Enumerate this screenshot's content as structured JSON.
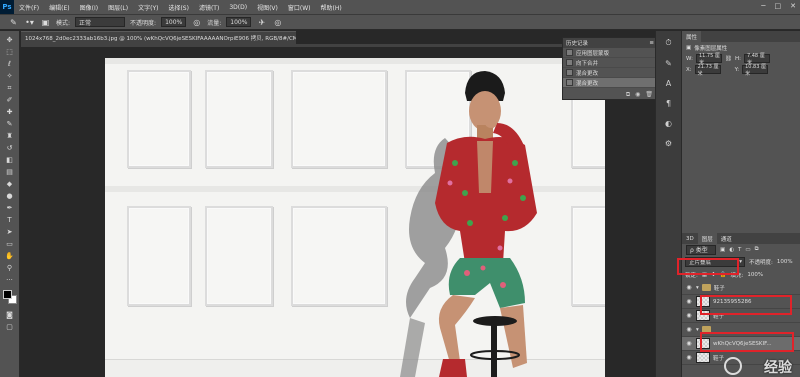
{
  "app": {
    "logo": "Ps"
  },
  "menu": [
    "文件(F)",
    "编辑(E)",
    "图像(I)",
    "图层(L)",
    "文字(Y)",
    "选择(S)",
    "滤镜(T)",
    "3D(D)",
    "视图(V)",
    "窗口(W)",
    "帮助(H)"
  ],
  "window_controls": [
    "─",
    "□",
    "✕"
  ],
  "options": {
    "mode_label": "模式:",
    "mode_value": "正常",
    "opacity_label": "不透明度:",
    "opacity_value": "100%",
    "flow_label": "流量:",
    "flow_value": "100%"
  },
  "document": {
    "tab_title": "1024x768_2d0ec2333ab16b3.jpg @ 100% (wKhQcVQ6jeSESKIFAAAAANOrpiE906 拷贝, RGB/8#/CMYK) *"
  },
  "history": {
    "title": "历史记录",
    "items": [
      "应用图层蒙版",
      "向下合并",
      "混合更改",
      "混合更改"
    ],
    "active_index": 3
  },
  "properties": {
    "tab": "属性",
    "title": "像素图层属性",
    "w_label": "W:",
    "w_value": "11.75 厘米",
    "h_label": "H:",
    "h_value": "7.48 厘米",
    "x_label": "X:",
    "x_value": "21.73 厘米",
    "y_label": "Y:",
    "y_value": "10.83 厘米",
    "link_icon": "link-icon"
  },
  "layers": {
    "tabs": [
      "3D",
      "图层",
      "通道"
    ],
    "active_tab": 1,
    "kind_label": "ρ 类型",
    "blend_mode": "正片叠底",
    "opacity_label": "不透明度:",
    "opacity_value": "100%",
    "fill_label": "填充:",
    "fill_value": "100%",
    "lock_label": "锁定:",
    "rows": [
      {
        "name": "鞋子",
        "type": "folder"
      },
      {
        "name": "92135955286",
        "type": "layer"
      },
      {
        "name": "鞋子",
        "type": "layer"
      },
      {
        "name": "",
        "type": "folder"
      },
      {
        "name": "wKhQcVQ6jeSESKIF...",
        "type": "layer"
      },
      {
        "name": "鞋子",
        "type": "layer"
      }
    ]
  },
  "colors": {
    "highlight": "#e0232a",
    "ui_bg": "#535353",
    "dark_bg": "#282828"
  },
  "watermark": "经验"
}
